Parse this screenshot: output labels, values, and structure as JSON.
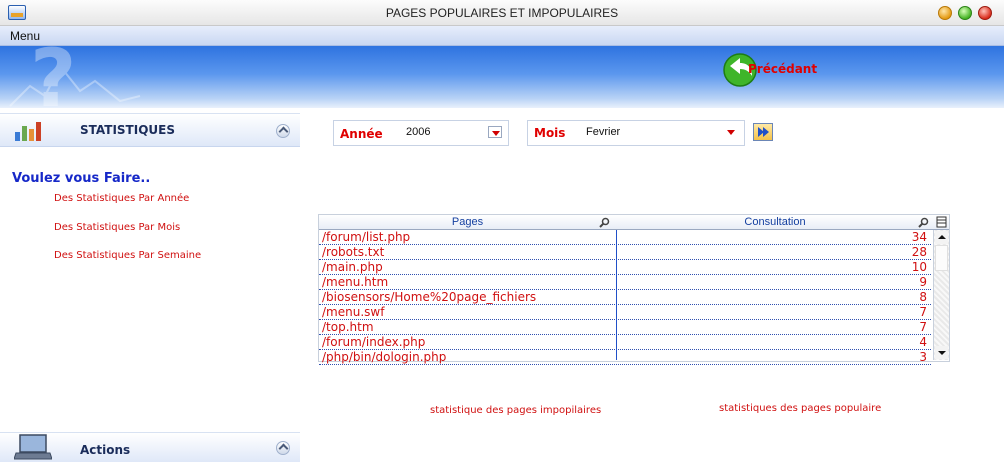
{
  "window": {
    "title": "PAGES POPULAIRES ET IMPOPULAIRES"
  },
  "menubar": {
    "items": [
      {
        "label": "Menu"
      }
    ]
  },
  "banner": {
    "back_label": "Précédant"
  },
  "sidebar": {
    "statistics_title": "STATISTIQUES",
    "question": "Voulez vous Faire..",
    "links": [
      {
        "label": "Des Statistiques Par Année"
      },
      {
        "label": "Des Statistiques Par Mois"
      },
      {
        "label": "Des Statistiques Par Semaine"
      }
    ],
    "actions_title": "Actions"
  },
  "filters": {
    "year_label": "Année",
    "year_value": "2006",
    "month_label": "Mois",
    "month_value": "Fevrier"
  },
  "table": {
    "columns": [
      "Pages",
      "Consultation"
    ],
    "rows": [
      {
        "page": "/forum/list.php",
        "count": "34"
      },
      {
        "page": "/robots.txt",
        "count": "28"
      },
      {
        "page": "/main.php",
        "count": "10"
      },
      {
        "page": "/menu.htm",
        "count": "9"
      },
      {
        "page": "/biosensors/Home%20page_fichiers",
        "count": "8"
      },
      {
        "page": "/menu.swf",
        "count": "7"
      },
      {
        "page": "/top.htm",
        "count": "7"
      },
      {
        "page": "/forum/index.php",
        "count": "4"
      },
      {
        "page": "/php/bin/dologin.php",
        "count": "3"
      }
    ]
  },
  "footer_links": {
    "unpopular": "statistique des pages impopilaires",
    "popular": "statistiques des pages populaire"
  },
  "colors": {
    "accent_red": "#d01010",
    "link_blue": "#1628c8",
    "banner_blue": "#2e73e0"
  }
}
